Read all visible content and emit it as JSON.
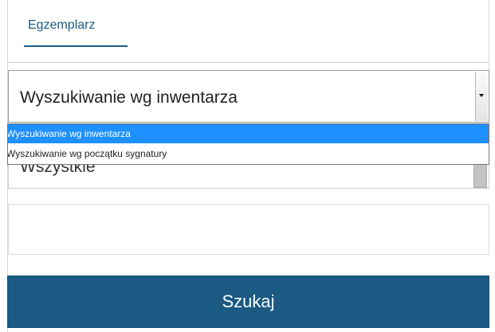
{
  "tabs": {
    "active_label": "Egzemplarz"
  },
  "search_type_select": {
    "value": "Wyszukiwanie wg inwentarza",
    "options": [
      "Wyszukiwanie wg inwentarza",
      "Wyszukiwanie wg początku sygnatury"
    ],
    "selected_index": 0
  },
  "scope_select": {
    "value": "Wszystkie"
  },
  "query_input": {
    "value": ""
  },
  "search_button": {
    "label": "Szukaj",
    "color": "#1a5a83"
  },
  "colors": {
    "accent": "#1b5b85",
    "option_highlight": "#1e90ff"
  }
}
